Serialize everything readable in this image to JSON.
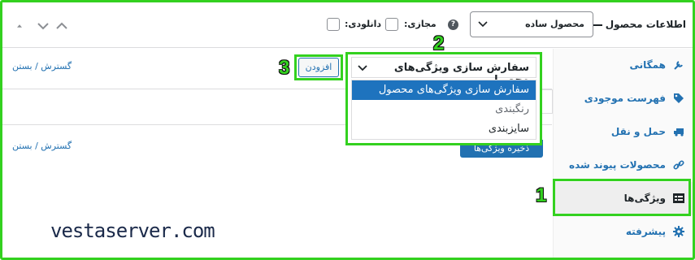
{
  "header": {
    "title": "اطلاعات محصول",
    "product_type": "محصول ساده",
    "virtual_label": "مجازی:",
    "downloadable_label": "دانلودی:",
    "help_glyph": "?",
    "icons": [
      "sort-up-icon",
      "chevron-down-icon",
      "chevron-up-icon"
    ]
  },
  "sidebar": {
    "items": [
      {
        "label": "همگانی",
        "icon": "wrench-icon"
      },
      {
        "label": "فهرست موجودی",
        "icon": "tag-icon"
      },
      {
        "label": "حمل و نقل",
        "icon": "truck-icon"
      },
      {
        "label": "محصولات پیوند شده",
        "icon": "link-icon"
      },
      {
        "label": "ویژگی‌ها",
        "icon": "list-icon",
        "active": true
      },
      {
        "label": "پیشرفته",
        "icon": "gear-icon"
      }
    ]
  },
  "main": {
    "expand_collapse_label": "گسترش / بستن",
    "add_button_label": "افزودن",
    "save_button_label": "ذخیره ویژگی‌ها"
  },
  "dropdown": {
    "selected": "سفارش سازی ویژگی‌های محصول",
    "options": [
      "سفارش سازی ویژگی‌های محصول",
      "رنگبندی",
      "سایزبندی"
    ]
  },
  "callouts": {
    "one": "1",
    "two": "2",
    "three": "3"
  },
  "watermark": "vestaserver.com",
  "colors": {
    "accent": "#2271b1",
    "highlight": "#33d11f",
    "selected": "#1e73be"
  }
}
